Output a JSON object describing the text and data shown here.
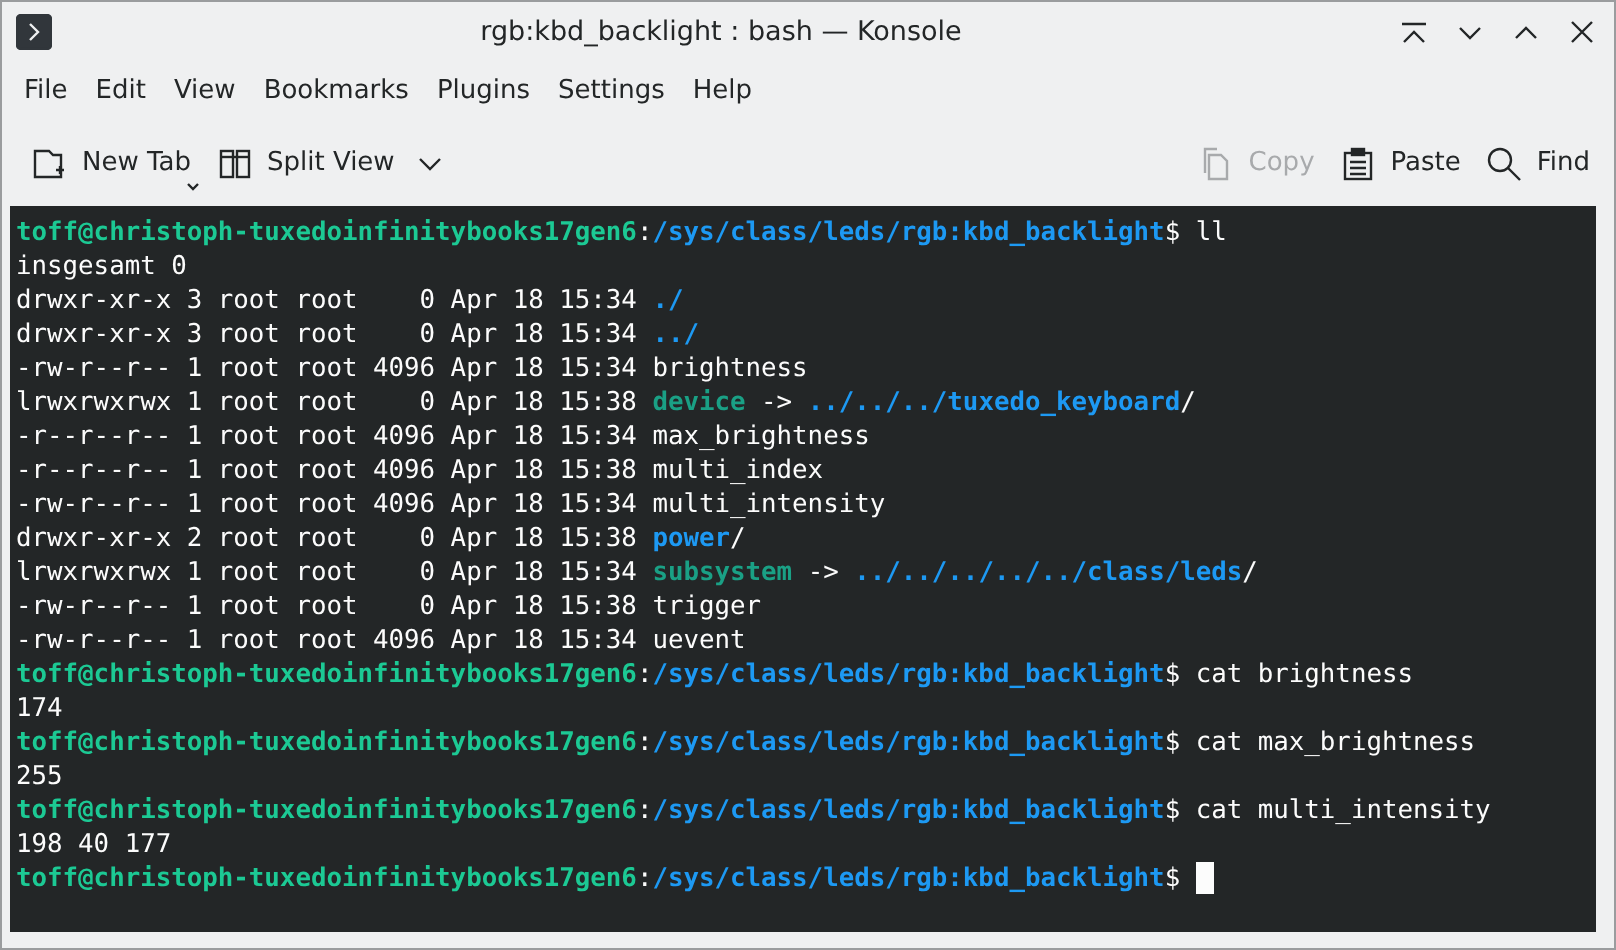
{
  "window": {
    "title": "rgb:kbd_backlight : bash — Konsole"
  },
  "menu": [
    "File",
    "Edit",
    "View",
    "Bookmarks",
    "Plugins",
    "Settings",
    "Help"
  ],
  "toolbar": {
    "left": [
      {
        "kind": "newtab",
        "label": "New Tab",
        "disabled": false
      },
      {
        "kind": "split",
        "label": "Split View",
        "disabled": false
      }
    ],
    "right": [
      {
        "kind": "copy",
        "label": "Copy",
        "disabled": true
      },
      {
        "kind": "paste",
        "label": "Paste",
        "disabled": false
      },
      {
        "kind": "find",
        "label": "Find",
        "disabled": false
      }
    ]
  },
  "terminal": {
    "cursor_visible": true,
    "lines": [
      [
        {
          "kind": "user",
          "text": "toff@christoph-tuxedoinfinitybooks17gen6"
        },
        {
          "kind": "plain",
          "text": ":"
        },
        {
          "kind": "path",
          "text": "/sys/class/leds/rgb:kbd_backlight"
        },
        {
          "kind": "plain",
          "text": "$ ll"
        }
      ],
      [
        {
          "kind": "plain",
          "text": "insgesamt 0"
        }
      ],
      [
        {
          "kind": "plain",
          "text": "drwxr-xr-x 3 root root    0 Apr 18 15:34 "
        },
        {
          "kind": "dir",
          "text": "./"
        }
      ],
      [
        {
          "kind": "plain",
          "text": "drwxr-xr-x 3 root root    0 Apr 18 15:34 "
        },
        {
          "kind": "dir",
          "text": "../"
        }
      ],
      [
        {
          "kind": "plain",
          "text": "-rw-r--r-- 1 root root 4096 Apr 18 15:34 brightness"
        }
      ],
      [
        {
          "kind": "plain",
          "text": "lrwxrwxrwx 1 root root    0 Apr 18 15:38 "
        },
        {
          "kind": "link",
          "text": "device"
        },
        {
          "kind": "plain",
          "text": " -> "
        },
        {
          "kind": "dir",
          "text": "../../../tuxedo_keyboard"
        },
        {
          "kind": "plain",
          "text": "/"
        }
      ],
      [
        {
          "kind": "plain",
          "text": "-r--r--r-- 1 root root 4096 Apr 18 15:34 max_brightness"
        }
      ],
      [
        {
          "kind": "plain",
          "text": "-r--r--r-- 1 root root 4096 Apr 18 15:38 multi_index"
        }
      ],
      [
        {
          "kind": "plain",
          "text": "-rw-r--r-- 1 root root 4096 Apr 18 15:34 multi_intensity"
        }
      ],
      [
        {
          "kind": "plain",
          "text": "drwxr-xr-x 2 root root    0 Apr 18 15:38 "
        },
        {
          "kind": "dir",
          "text": "power"
        },
        {
          "kind": "plain",
          "text": "/"
        }
      ],
      [
        {
          "kind": "plain",
          "text": "lrwxrwxrwx 1 root root    0 Apr 18 15:34 "
        },
        {
          "kind": "link",
          "text": "subsystem"
        },
        {
          "kind": "plain",
          "text": " -> "
        },
        {
          "kind": "dir",
          "text": "../../../../../class/leds"
        },
        {
          "kind": "plain",
          "text": "/"
        }
      ],
      [
        {
          "kind": "plain",
          "text": "-rw-r--r-- 1 root root    0 Apr 18 15:38 trigger"
        }
      ],
      [
        {
          "kind": "plain",
          "text": "-rw-r--r-- 1 root root 4096 Apr 18 15:34 uevent"
        }
      ],
      [
        {
          "kind": "user",
          "text": "toff@christoph-tuxedoinfinitybooks17gen6"
        },
        {
          "kind": "plain",
          "text": ":"
        },
        {
          "kind": "path",
          "text": "/sys/class/leds/rgb:kbd_backlight"
        },
        {
          "kind": "plain",
          "text": "$ cat brightness"
        }
      ],
      [
        {
          "kind": "plain",
          "text": "174"
        }
      ],
      [
        {
          "kind": "user",
          "text": "toff@christoph-tuxedoinfinitybooks17gen6"
        },
        {
          "kind": "plain",
          "text": ":"
        },
        {
          "kind": "path",
          "text": "/sys/class/leds/rgb:kbd_backlight"
        },
        {
          "kind": "plain",
          "text": "$ cat max_brightness"
        }
      ],
      [
        {
          "kind": "plain",
          "text": "255"
        }
      ],
      [
        {
          "kind": "user",
          "text": "toff@christoph-tuxedoinfinitybooks17gen6"
        },
        {
          "kind": "plain",
          "text": ":"
        },
        {
          "kind": "path",
          "text": "/sys/class/leds/rgb:kbd_backlight"
        },
        {
          "kind": "plain",
          "text": "$ cat multi_intensity"
        }
      ],
      [
        {
          "kind": "plain",
          "text": "198 40 177"
        }
      ],
      [
        {
          "kind": "user",
          "text": "toff@christoph-tuxedoinfinitybooks17gen6"
        },
        {
          "kind": "plain",
          "text": ":"
        },
        {
          "kind": "path",
          "text": "/sys/class/leds/rgb:kbd_backlight"
        },
        {
          "kind": "plain",
          "text": "$ "
        }
      ]
    ]
  }
}
